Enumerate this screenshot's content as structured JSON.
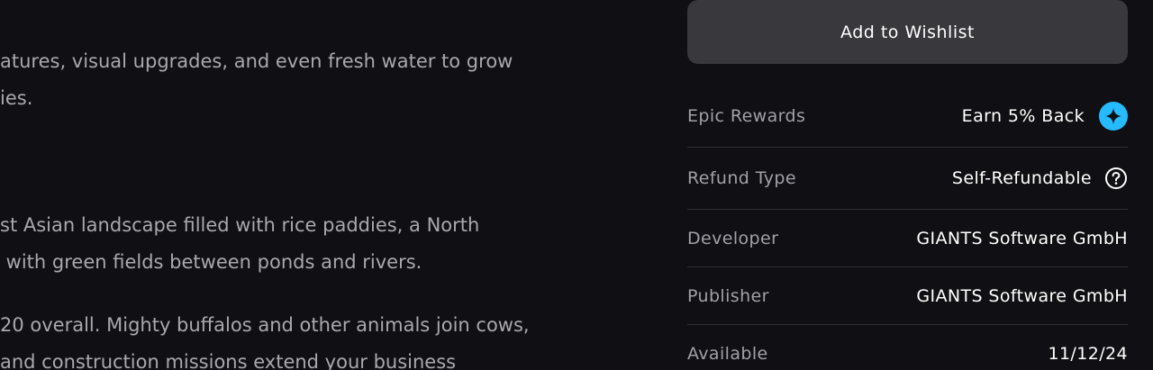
{
  "description": {
    "lines": [
      "atures, visual upgrades, and even fresh water to grow",
      "ies.",
      "st Asian landscape filled with rice paddies, a North",
      " with green fields between ponds and rivers.",
      "20 overall. Mighty buffalos and other animals join cows,",
      "and construction missions extend your business"
    ]
  },
  "sidebar": {
    "wishlist_label": "Add to Wishlist",
    "rewards": {
      "label": "Epic Rewards",
      "value": "Earn 5% Back",
      "icon": "epic-rewards-star-icon",
      "icon_color": "#26bbff"
    },
    "refund": {
      "label": "Refund Type",
      "value": "Self-Refundable",
      "icon": "help-circle-icon"
    },
    "developer": {
      "label": "Developer",
      "value": "GIANTS Software GmbH"
    },
    "publisher": {
      "label": "Publisher",
      "value": "GIANTS Software GmbH"
    },
    "available": {
      "label": "Available",
      "value": "11/12/24"
    }
  },
  "colors": {
    "background": "#101014",
    "button_bg": "#38383d",
    "divider": "#2e2e33",
    "accent": "#26bbff"
  }
}
